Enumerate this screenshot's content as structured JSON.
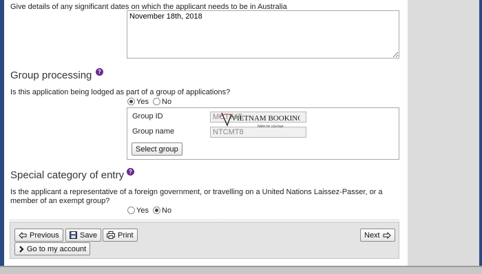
{
  "dates_question": "Give details of any significant dates on which the applicant needs to be in Australia",
  "dates_value": "November 18th, 2018",
  "group": {
    "title": "Group processing",
    "question": "Is this application being lodged as part of a group of applications?",
    "yes_label": "Yes",
    "no_label": "No",
    "selected": "yes",
    "id_label": "Group ID",
    "id_value": "MCT74T",
    "name_label": "Group name",
    "name_value": "NTCMT8",
    "select_button": "Select group"
  },
  "special": {
    "title": "Special category of entry",
    "question_line1": "Is the applicant a representative of a foreign government, or travelling on a United Nations Laissez-Passer, or a",
    "question_line2": "member of an exempt group?",
    "yes_label": "Yes",
    "no_label": "No",
    "selected": "no"
  },
  "nav": {
    "previous": "Previous",
    "save": "Save",
    "print": "Print",
    "next": "Next",
    "account": "Go to my account"
  },
  "watermark": {
    "brand": "VIETNAM BOOKING",
    "tagline": "Niềm tin của bạn"
  },
  "colors": {
    "help_icon": "#6a2a8a",
    "frame": "#2a4a80"
  }
}
